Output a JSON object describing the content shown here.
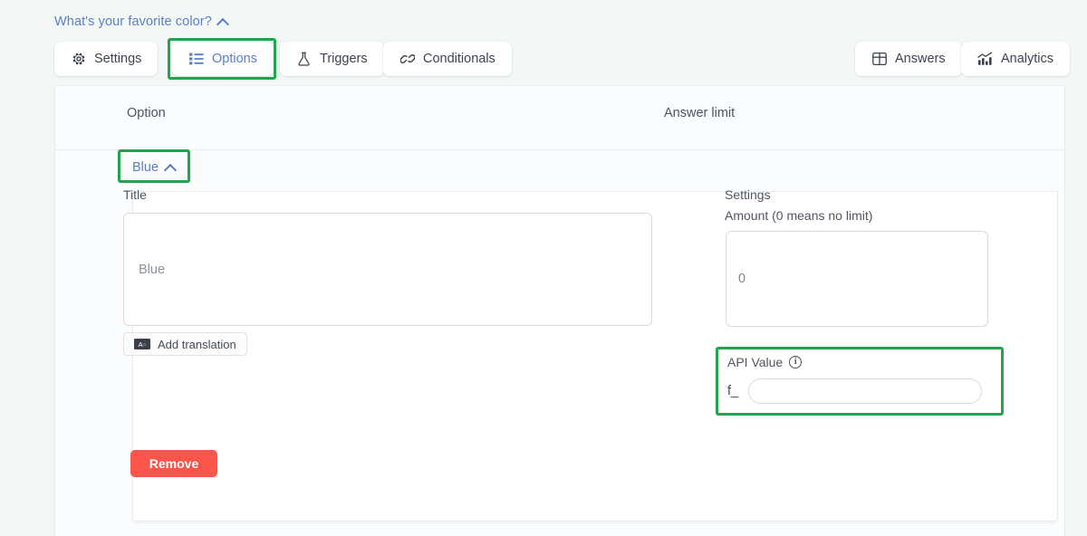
{
  "header": {
    "question_title": "What's your favorite color?",
    "collapse_icon": "chevron-up-icon"
  },
  "tabs": {
    "left": [
      {
        "label": "Settings",
        "icon": "gear-icon",
        "active": false
      },
      {
        "label": "Options",
        "icon": "list-icon",
        "active": true
      },
      {
        "label": "Triggers",
        "icon": "flask-icon",
        "active": false
      },
      {
        "label": "Conditionals",
        "icon": "link-icon",
        "active": false
      }
    ],
    "right": [
      {
        "label": "Answers",
        "icon": "table-grid-icon",
        "active": false
      },
      {
        "label": "Analytics",
        "icon": "bar-chart-icon",
        "active": false
      }
    ]
  },
  "table": {
    "columns": {
      "option": "Option",
      "answer_limit": "Answer limit"
    }
  },
  "option_row": {
    "name": "Blue",
    "expand_icon": "chevron-up-icon"
  },
  "editor": {
    "title_label": "Title",
    "title_value": "Blue",
    "title_placeholder": "Blue",
    "add_translation_label": "Add translation",
    "translation_icon": "translate-icon",
    "translation_icon_text": "A文",
    "remove_label": "Remove"
  },
  "settings": {
    "settings_label": "Settings",
    "amount_label": "Amount (0 means no limit)",
    "amount_value": "0",
    "amount_placeholder": "0",
    "api_value_label": "API Value",
    "api_info_icon": "info-icon",
    "api_info_char": "i",
    "api_prefix": "f_",
    "api_value": "",
    "api_placeholder": ""
  },
  "colors": {
    "highlight_green": "#22a44c",
    "link_blue": "#5a7fc6",
    "danger_red": "#f9554a",
    "page_background": "#f3f8f7",
    "panel_background": "#fbfcfd"
  }
}
